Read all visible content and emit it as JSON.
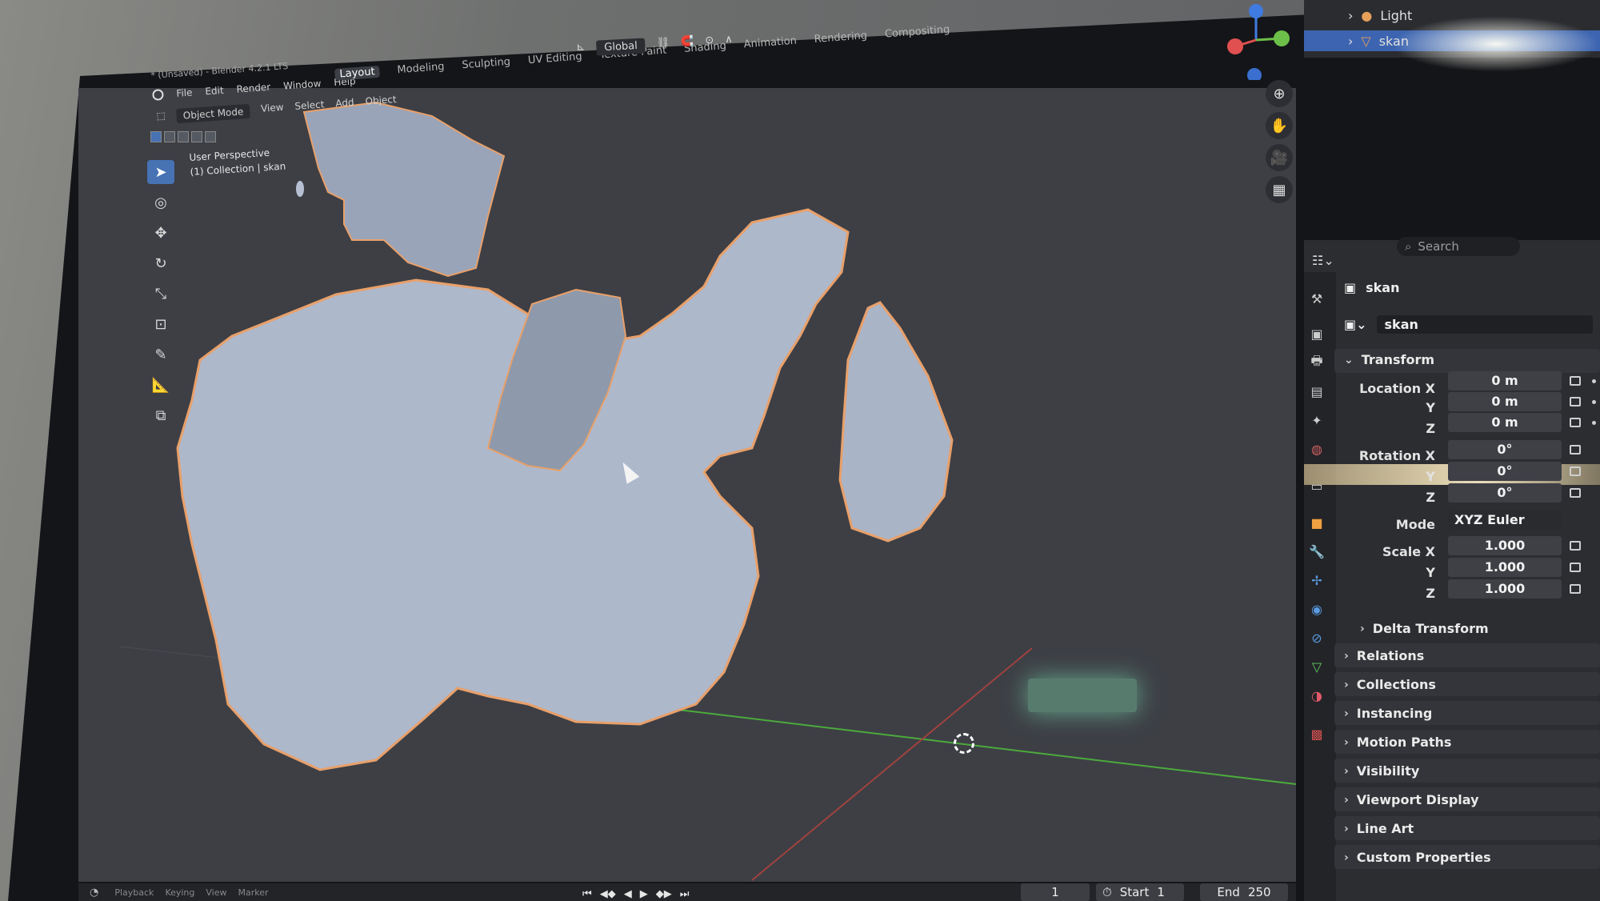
{
  "window": {
    "title": "* (Unsaved) - Blender 4.2.1 LTS"
  },
  "menu": [
    "File",
    "Edit",
    "Render",
    "Window",
    "Help"
  ],
  "workspaces": [
    "Layout",
    "Modeling",
    "Sculpting",
    "UV Editing",
    "Texture Paint",
    "Shading",
    "Animation",
    "Rendering",
    "Compositing"
  ],
  "viewport_header": {
    "mode": "Object Mode",
    "items": [
      "View",
      "Select",
      "Add",
      "Object"
    ],
    "orientation": "Global"
  },
  "viewport": {
    "perspective": "User Perspective",
    "collection": "(1) Collection | skan"
  },
  "outliner": {
    "rows": [
      {
        "label": "Light"
      },
      {
        "label": "skan",
        "selected": true
      }
    ]
  },
  "properties": {
    "search_placeholder": "Search",
    "object_name": "skan",
    "data_name": "skan",
    "transform": {
      "header": "Transform",
      "location_label": "Location X",
      "location": [
        "0 m",
        "0 m",
        "0 m"
      ],
      "rotation_label": "Rotation X",
      "rotation": [
        "0°",
        "0°",
        "0°"
      ],
      "mode_label": "Mode",
      "mode": "XYZ Euler",
      "scale_label": "Scale X",
      "scale": [
        "1.000",
        "1.000",
        "1.000"
      ],
      "y": "Y",
      "z": "Z"
    },
    "sections": [
      "Delta Transform",
      "Relations",
      "Collections",
      "Instancing",
      "Motion Paths",
      "Visibility",
      "Viewport Display",
      "Line Art",
      "Custom Properties"
    ]
  },
  "timeline": {
    "current_frame": "1",
    "start_label": "Start",
    "start": "1",
    "end_label": "End",
    "end": "250",
    "menu": [
      "Playback",
      "Keying",
      "View",
      "Marker"
    ]
  },
  "colors": {
    "accent": "#4772b3",
    "viewport_bg": "#3d3f45",
    "mesh": "#aeb8cb",
    "outline": "#e8a06a"
  }
}
